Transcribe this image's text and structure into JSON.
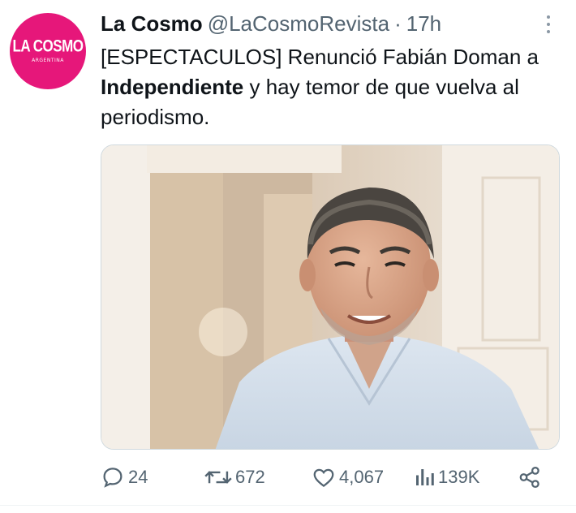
{
  "tweet": {
    "avatar": {
      "logo": "LA COSMO",
      "sub": "ARGENTINA",
      "color": "#e6177a"
    },
    "author_name": "La Cosmo",
    "handle": "@LaCosmoRevista",
    "separator": "·",
    "time": "17h",
    "text_before": "[ESPECTACULOS] Renunció Fabián Doman a ",
    "text_bold": "Independiente",
    "text_after": " y hay temor de que vuelva al periodismo.",
    "media_alt": "photo of a smiling man in a light blue shirt",
    "actions": {
      "replies": "24",
      "reposts": "672",
      "likes": "4,067",
      "views": "139K"
    }
  },
  "icons": {
    "more": "more-vertical-icon",
    "reply": "reply-icon",
    "repost": "repost-icon",
    "like": "heart-icon",
    "views": "views-chart-icon",
    "share": "share-icon"
  },
  "colors": {
    "text": "#0f1419",
    "muted": "#536471",
    "brand": "#e6177a"
  }
}
